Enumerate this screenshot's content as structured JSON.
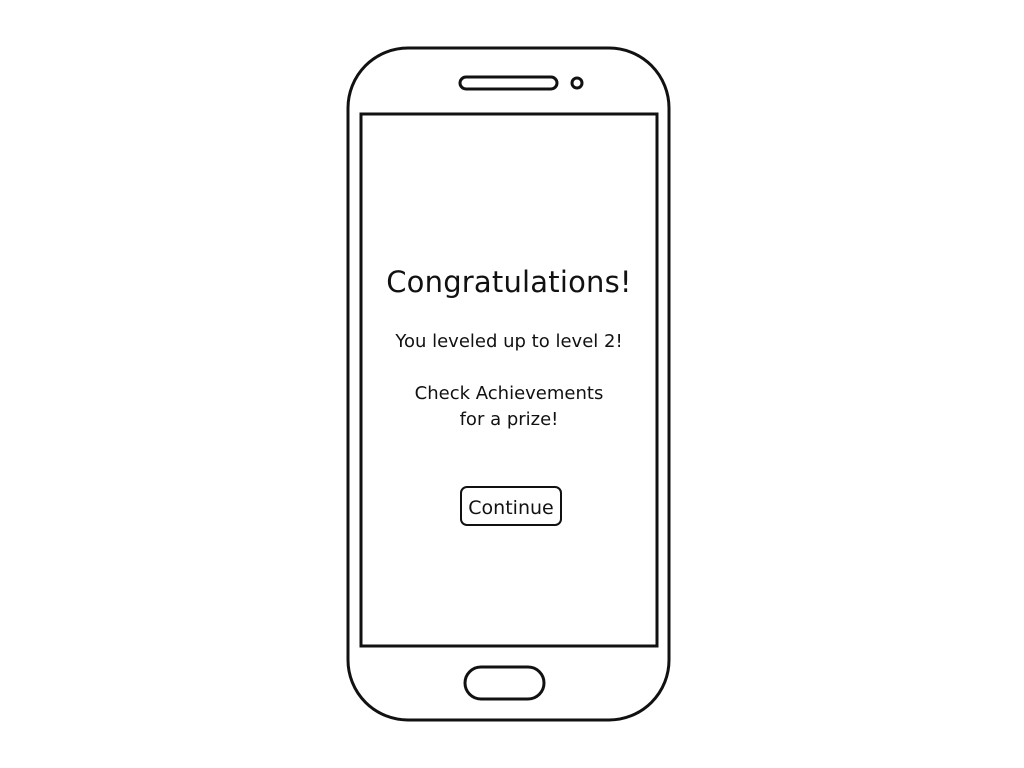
{
  "screen": {
    "title": "Congratulations!",
    "level_message": "You leveled up to level 2!",
    "prize_message_line1": "Check Achievements",
    "prize_message_line2": "for a prize!",
    "continue_label": "Continue"
  },
  "colors": {
    "stroke": "#111111",
    "background": "#ffffff"
  },
  "icons": {
    "speaker": "speaker-grille-icon",
    "camera": "front-camera-icon",
    "home": "home-button-icon"
  }
}
